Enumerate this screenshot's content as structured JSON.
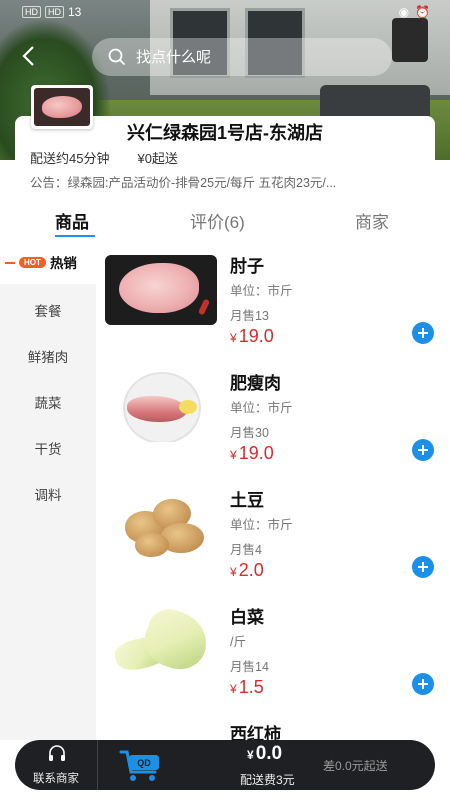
{
  "status_bar": {
    "left_chips": [
      "HD",
      "HD"
    ],
    "left_text": "13",
    "right_text": ""
  },
  "search": {
    "placeholder": "找点什么呢"
  },
  "store": {
    "name": "兴仁绿森园1号店-东湖店",
    "delivery_time": "配送约45分钟",
    "min_start": "¥0起送",
    "notice": "公告：绿森园:产品活动价-排骨25元/每斤  五花肉23元/..."
  },
  "tabs": [
    {
      "label": "商品",
      "active": true
    },
    {
      "label": "评价(6)",
      "active": false
    },
    {
      "label": "商家",
      "active": false
    }
  ],
  "categories": [
    {
      "label": "热销",
      "badge": "HOT",
      "active": true
    },
    {
      "label": "套餐"
    },
    {
      "label": "鲜猪肉"
    },
    {
      "label": "蔬菜"
    },
    {
      "label": "干货"
    },
    {
      "label": "调料"
    }
  ],
  "currency": "¥",
  "products": [
    {
      "name": "肘子",
      "unit": "单位：市斤",
      "sold": "月售13",
      "price": "19.0"
    },
    {
      "name": "肥瘦肉",
      "unit": "单位：市斤",
      "sold": "月售30",
      "price": "19.0"
    },
    {
      "name": "土豆",
      "unit": "单位：市斤",
      "sold": "月售4",
      "price": "2.0"
    },
    {
      "name": "白菜",
      "unit": "/斤",
      "sold": "月售14",
      "price": "1.5"
    },
    {
      "name": "西红柿",
      "unit": "",
      "sold": "",
      "price": ""
    }
  ],
  "bottom_bar": {
    "contact_label": "联系商家",
    "total": "0.0",
    "delivery_fee": "配送费3元",
    "min_order_hint": "差0.0元起送"
  },
  "colors": {
    "accent": "#1c8fe6",
    "price": "#d92b2b",
    "bar": "#1f2023",
    "hot": "#ee6322"
  }
}
